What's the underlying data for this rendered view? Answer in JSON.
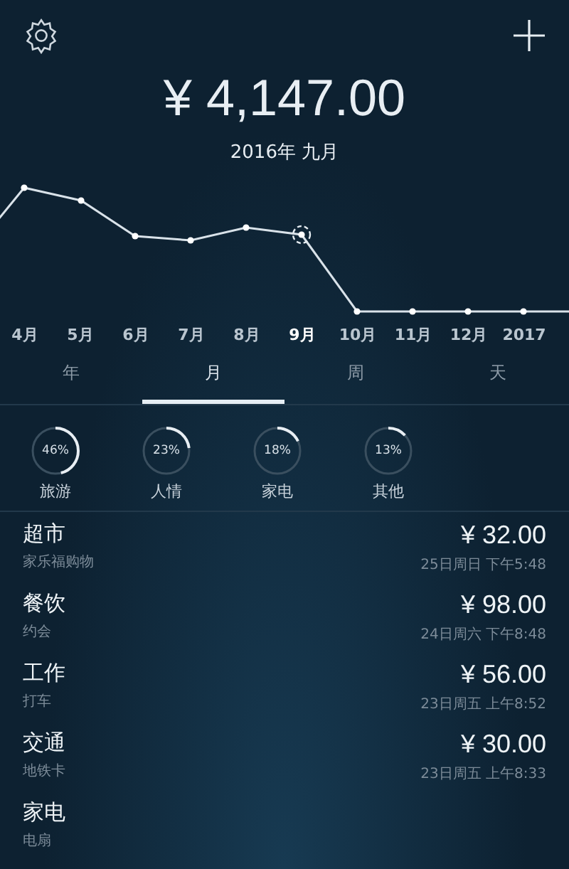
{
  "total": "¥ 4,147.00",
  "period": "2016年 九月",
  "chart_labels": [
    {
      "text": "4月",
      "selected": false
    },
    {
      "text": "5月",
      "selected": false
    },
    {
      "text": "6月",
      "selected": false
    },
    {
      "text": "7月",
      "selected": false
    },
    {
      "text": "8月",
      "selected": false
    },
    {
      "text": "9月",
      "selected": true
    },
    {
      "text": "10月",
      "selected": false
    },
    {
      "text": "11月",
      "selected": false
    },
    {
      "text": "12月",
      "selected": false
    },
    {
      "text": "2017",
      "selected": false
    }
  ],
  "tabs": [
    {
      "label": "年",
      "selected": false
    },
    {
      "label": "月",
      "selected": true
    },
    {
      "label": "周",
      "selected": false
    },
    {
      "label": "天",
      "selected": false
    }
  ],
  "categories": [
    {
      "name": "旅游",
      "percent": "46%",
      "level": 0.46
    },
    {
      "name": "人情",
      "percent": "23%",
      "level": 0.23
    },
    {
      "name": "家电",
      "percent": "18%",
      "level": 0.18
    },
    {
      "name": "其他",
      "percent": "13%",
      "level": 0.13
    }
  ],
  "entries": [
    {
      "category": "超市",
      "note": "家乐福购物",
      "amount": "¥ 32.00",
      "time": "25日周日 下午5:48"
    },
    {
      "category": "餐饮",
      "note": "约会",
      "amount": "¥ 98.00",
      "time": "24日周六 下午8:48"
    },
    {
      "category": "工作",
      "note": "打车",
      "amount": "¥ 56.00",
      "time": "23日周五 上午8:52"
    },
    {
      "category": "交通",
      "note": "地铁卡",
      "amount": "¥ 30.00",
      "time": "23日周五 上午8:33"
    },
    {
      "category": "家电",
      "note": "电扇"
    }
  ]
}
